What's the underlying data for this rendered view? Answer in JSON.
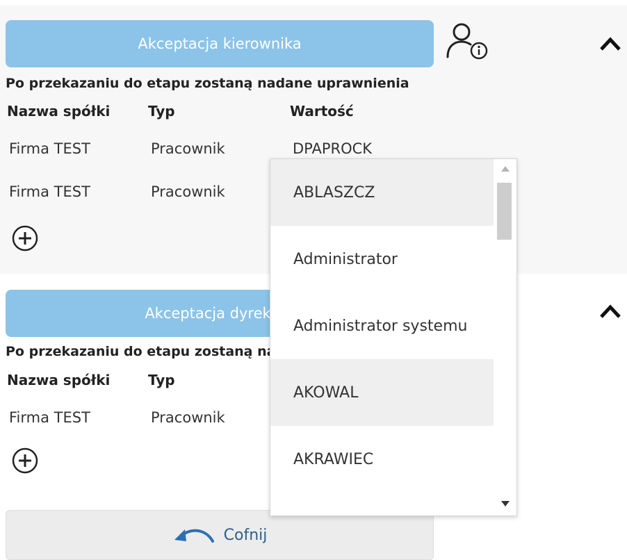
{
  "stages": [
    {
      "button_label": "Akceptacja kierownika",
      "info_text": "Po przekazaniu do etapu zostaną nadane uprawnienia",
      "headers": {
        "company": "Nazwa spółki",
        "type": "Typ",
        "value": "Wartość"
      },
      "rows": [
        {
          "company": "Firma TEST",
          "type": "Pracownik",
          "value": "DPAPROCK"
        },
        {
          "company": "Firma TEST",
          "type": "Pracownik",
          "value": ""
        }
      ]
    },
    {
      "button_label": "Akceptacja dyrek",
      "info_text": "Po przekazaniu do etapu zostaną na",
      "headers": {
        "company": "Nazwa spółki",
        "type": "Typ"
      },
      "rows": [
        {
          "company": "Firma TEST",
          "type": "Pracownik"
        }
      ]
    }
  ],
  "dropdown": {
    "options": [
      "ABLASZCZ",
      "Administrator",
      "Administrator systemu",
      "AKOWAL",
      "AKRAWIEC"
    ],
    "highlighted": [
      "ABLASZCZ",
      "AKOWAL"
    ]
  },
  "footer": {
    "back_label": "Cofnij"
  },
  "icons": {
    "user_info": "user-info-icon",
    "collapse": "chevron-up-icon",
    "add": "plus-circle-icon",
    "back": "undo-arrow-icon"
  },
  "colors": {
    "stage_button": "#8cc3e8",
    "section_bg": "#f7f7f7",
    "back_icon": "#2c6fb3"
  }
}
